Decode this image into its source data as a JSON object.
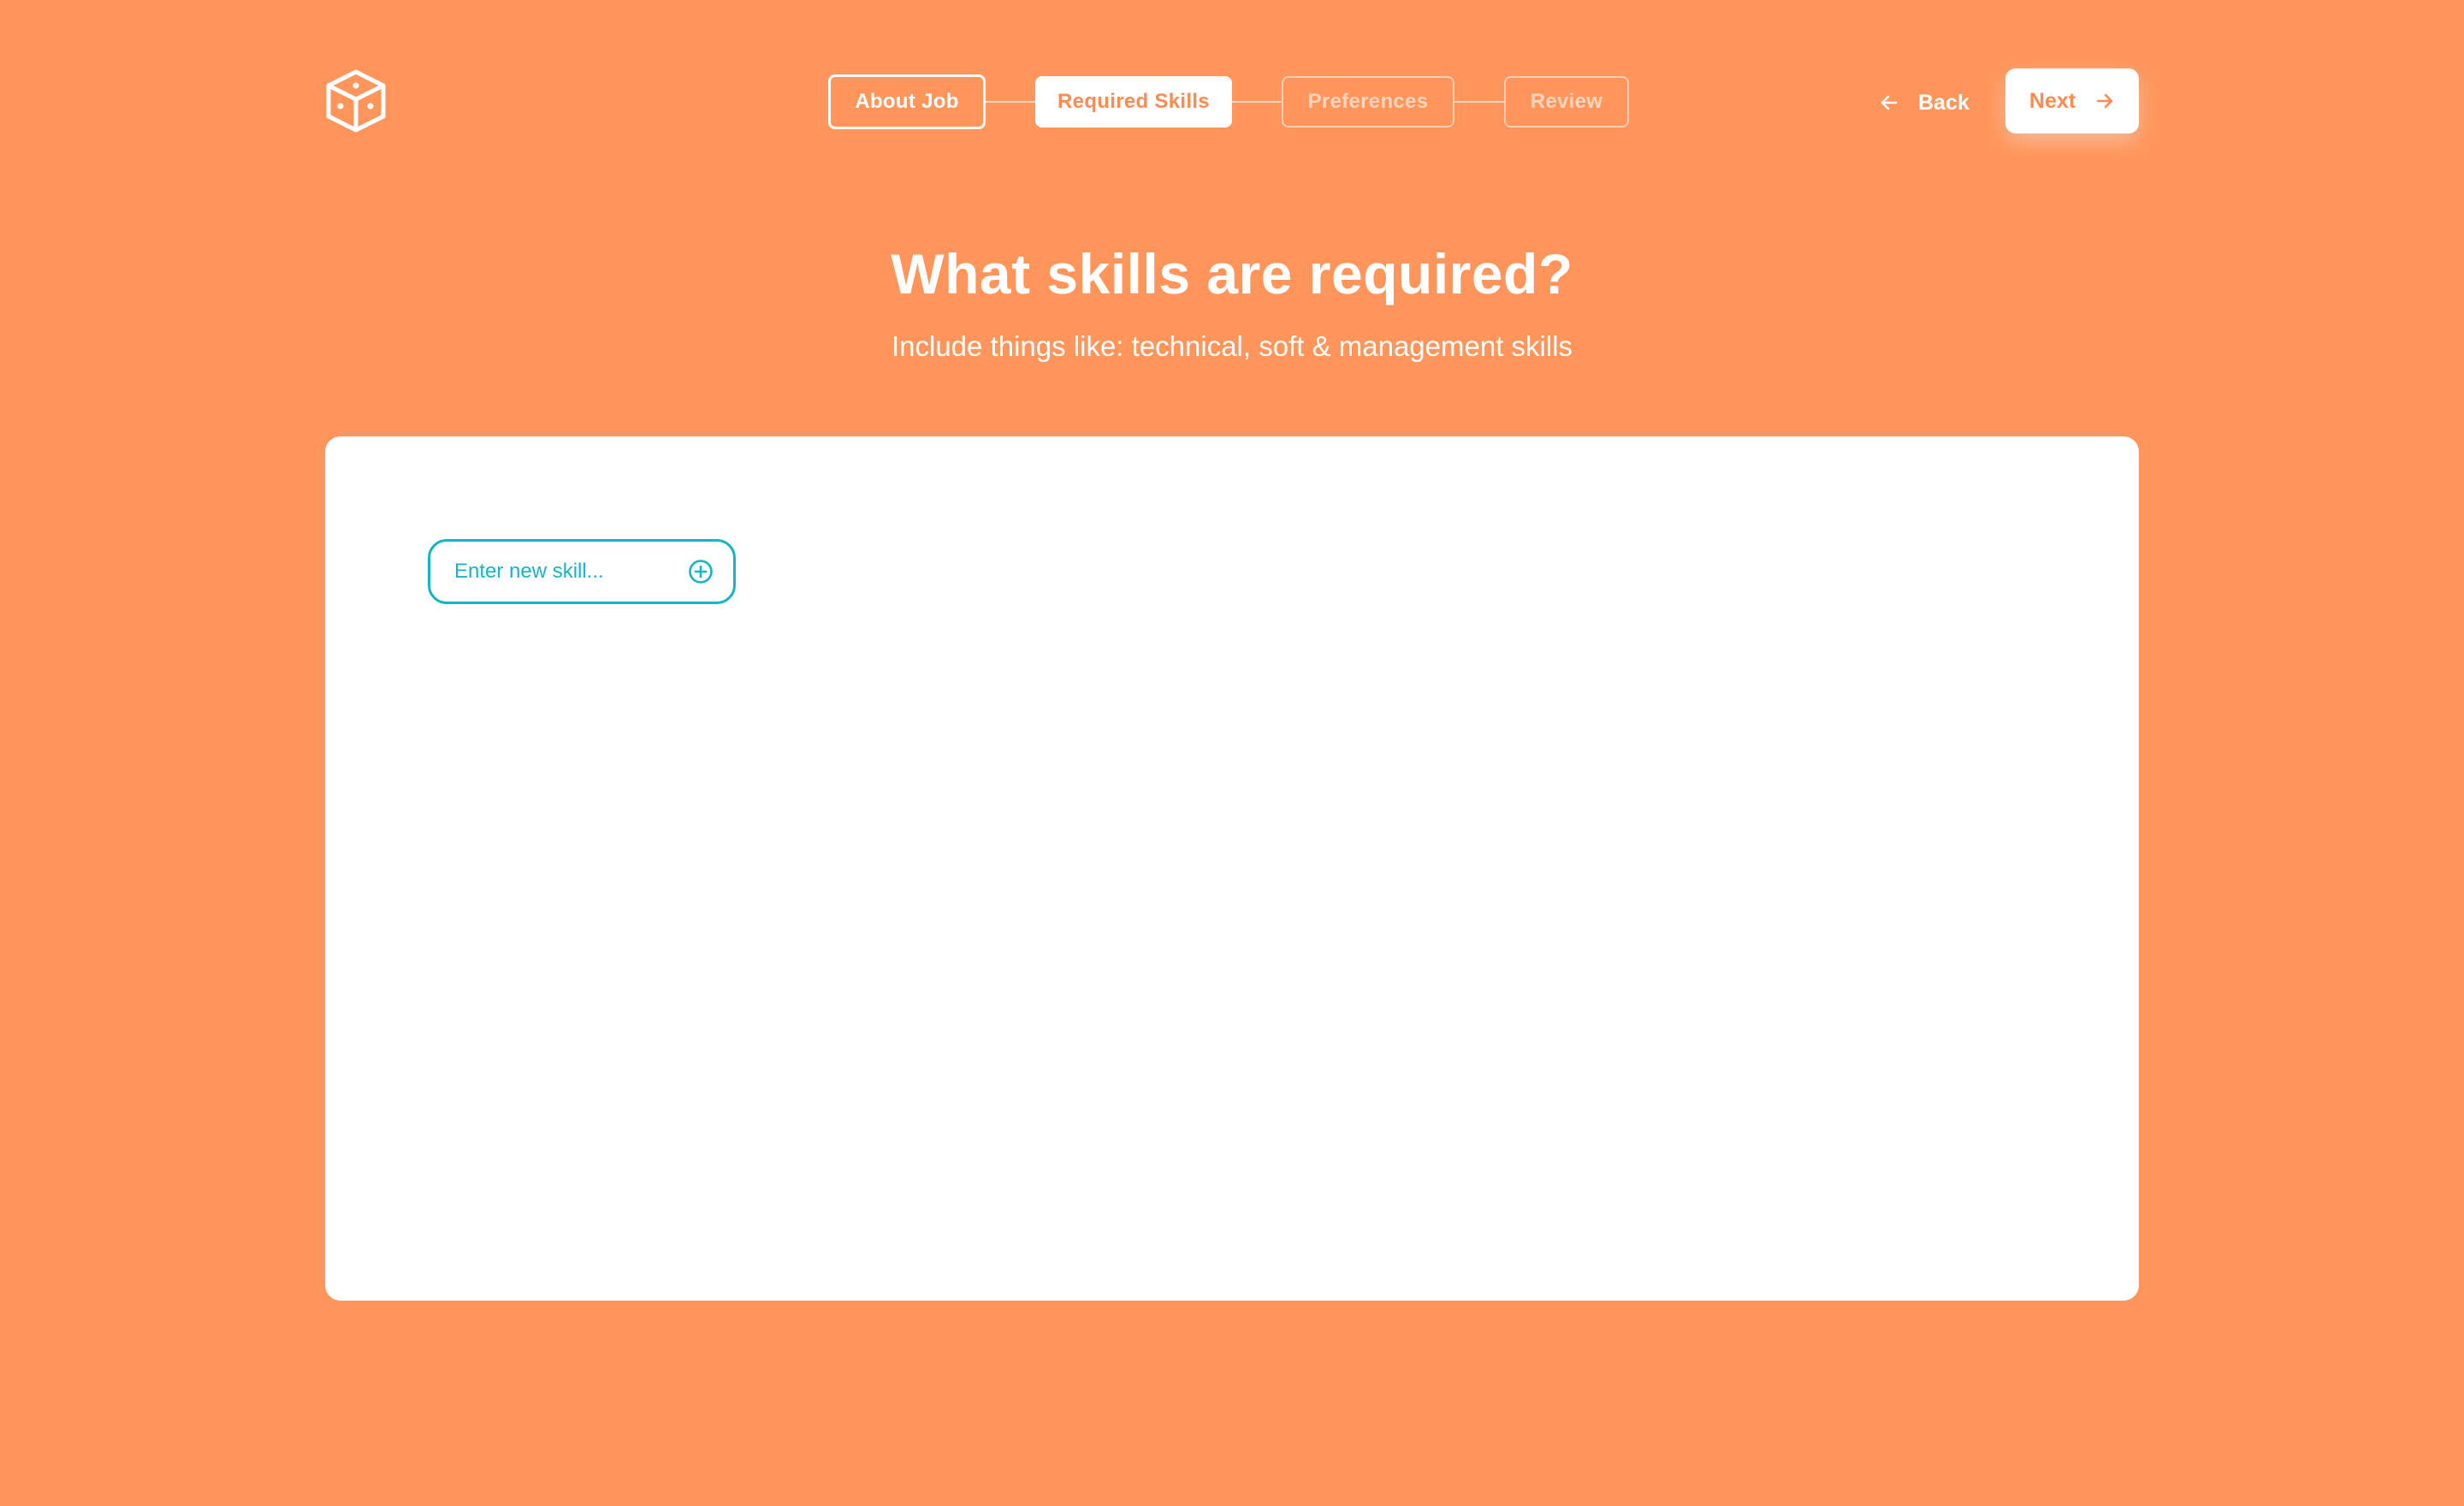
{
  "header": {
    "logo_icon": "cube-icon",
    "steps": [
      {
        "label": "About Job",
        "state": "done"
      },
      {
        "label": "Required Skills",
        "state": "active"
      },
      {
        "label": "Preferences",
        "state": "upcoming"
      },
      {
        "label": "Review",
        "state": "upcoming"
      }
    ],
    "back_label": "Back",
    "back_icon": "arrow-left-icon",
    "next_label": "Next",
    "next_icon": "arrow-right-icon"
  },
  "main": {
    "title": "What skills are required?",
    "subtitle": "Include things like: technical, soft & management skills",
    "skill_input": {
      "value": "",
      "placeholder": "Enter new skill...",
      "add_icon": "plus-circle-icon"
    }
  },
  "colors": {
    "background": "#FF955A",
    "accent": "#FF8A50",
    "input_accent": "#16B5C5",
    "card": "#FFFFFF"
  }
}
